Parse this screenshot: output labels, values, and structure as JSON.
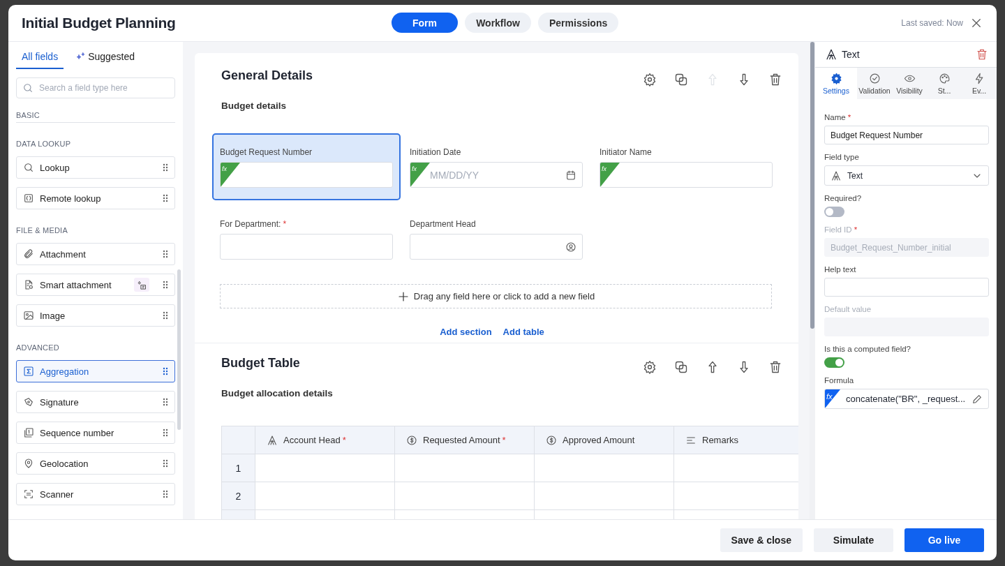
{
  "window": {
    "title": "Initial Budget Planning",
    "last_saved": "Last saved: Now"
  },
  "top_tabs": [
    {
      "label": "Form",
      "selected": true
    },
    {
      "label": "Workflow",
      "selected": false
    },
    {
      "label": "Permissions",
      "selected": false
    }
  ],
  "palette": {
    "tabs": [
      {
        "label": "All fields",
        "selected": true,
        "kind": "plain"
      },
      {
        "label": "Suggested",
        "selected": false,
        "kind": "ai"
      }
    ],
    "search": {
      "placeholder": "Search a field type here"
    },
    "groups": [
      {
        "title": "BASIC"
      },
      {
        "title": "DATA LOOKUP",
        "items": [
          {
            "label": "Lookup",
            "kind": "search",
            "selected": false,
            "ai": false
          },
          {
            "label": "Remote lookup",
            "kind": "braces",
            "selected": false,
            "ai": false
          }
        ]
      },
      {
        "title": "FILE & MEDIA",
        "items": [
          {
            "label": "Attachment",
            "kind": "clip",
            "selected": false,
            "ai": false
          },
          {
            "label": "Smart attachment",
            "kind": "doc",
            "selected": false,
            "ai": true
          },
          {
            "label": "Image",
            "kind": "image",
            "selected": false,
            "ai": false
          }
        ]
      },
      {
        "title": "ADVANCED",
        "items": [
          {
            "label": "Aggregation",
            "kind": "sigma",
            "selected": true,
            "ai": false
          },
          {
            "label": "Signature",
            "kind": "pen",
            "selected": false,
            "ai": false
          },
          {
            "label": "Sequence number",
            "kind": "seq",
            "selected": false,
            "ai": false
          },
          {
            "label": "Geolocation",
            "kind": "pin",
            "selected": false,
            "ai": false
          },
          {
            "label": "Scanner",
            "kind": "scan",
            "selected": false,
            "ai": false
          }
        ]
      }
    ]
  },
  "sections": [
    {
      "title": "General Details",
      "subtitle": "Budget details",
      "kind": "fields",
      "actions": [
        {
          "kind": "settings",
          "disabled": false
        },
        {
          "kind": "copy",
          "disabled": false
        },
        {
          "kind": "up",
          "disabled": true
        },
        {
          "kind": "down",
          "disabled": false
        },
        {
          "kind": "delete",
          "disabled": false
        }
      ],
      "rows": [
        [
          {
            "label": "Budget Request Number",
            "formula_badge": "fx",
            "selected": true,
            "kind": "text"
          },
          {
            "label": "Initiation Date",
            "formula_badge": "fx",
            "selected": false,
            "placeholder": "MM/DD/YY",
            "kind": "date"
          },
          {
            "label": "Initiator Name",
            "formula_badge": "fx",
            "selected": false,
            "kind": "text"
          }
        ],
        [
          {
            "label": "For Department:",
            "required_mark": "*",
            "selected": false,
            "kind": "text"
          },
          {
            "label": "Department Head",
            "selected": false,
            "kind": "person"
          }
        ]
      ],
      "dropzone": "Drag any field here or click to add a new field",
      "links": [
        "Add section",
        "Add table"
      ]
    },
    {
      "title": "Budget Table",
      "subtitle": "Budget allocation details",
      "kind": "table",
      "actions": [
        {
          "kind": "settings",
          "disabled": false
        },
        {
          "kind": "copy",
          "disabled": false
        },
        {
          "kind": "up",
          "disabled": false
        },
        {
          "kind": "down",
          "disabled": false
        },
        {
          "kind": "delete",
          "disabled": false
        }
      ],
      "columns": [
        {
          "label": "Account Head",
          "kind": "text",
          "required_mark": "*"
        },
        {
          "label": "Requested Amount",
          "kind": "dollar",
          "required_mark": "*"
        },
        {
          "label": "Approved Amount",
          "kind": "dollar"
        },
        {
          "label": "Remarks",
          "kind": "lines"
        }
      ],
      "rows": [
        "1",
        "2"
      ]
    }
  ],
  "properties": {
    "title": "Text",
    "tabs": [
      {
        "label": "Settings",
        "kind": "gear",
        "selected": true
      },
      {
        "label": "Validation",
        "kind": "check",
        "selected": false
      },
      {
        "label": "Visibility",
        "kind": "eye",
        "selected": false
      },
      {
        "label": "St...",
        "kind": "palette",
        "selected": false
      },
      {
        "label": "Ev...",
        "kind": "bolt",
        "selected": false
      }
    ],
    "fields": [
      {
        "kind": "input",
        "label": "Name",
        "required_mark": "*",
        "disabled": false,
        "value": "Budget Request Number"
      },
      {
        "kind": "select",
        "label": "Field type",
        "value": "Text"
      },
      {
        "kind": "toggle",
        "label": "Required?",
        "on": false
      },
      {
        "kind": "input",
        "label": "Field ID",
        "required_mark": "*",
        "disabled": true,
        "value": "Budget_Request_Number_initial"
      },
      {
        "kind": "input",
        "label": "Help text",
        "disabled": false
      },
      {
        "kind": "input",
        "label": "Default value",
        "disabled": true
      },
      {
        "kind": "toggle",
        "label": "Is this a computed field?",
        "on": true
      },
      {
        "kind": "formula",
        "label": "Formula",
        "formula_badge": "fx",
        "value": "concatenate(\"BR\", _request..."
      }
    ]
  },
  "footer": {
    "buttons": [
      {
        "label": "Save & close",
        "kind": "secondary"
      },
      {
        "label": "Simulate",
        "kind": "secondary"
      },
      {
        "label": "Go live",
        "kind": "primary"
      }
    ]
  }
}
